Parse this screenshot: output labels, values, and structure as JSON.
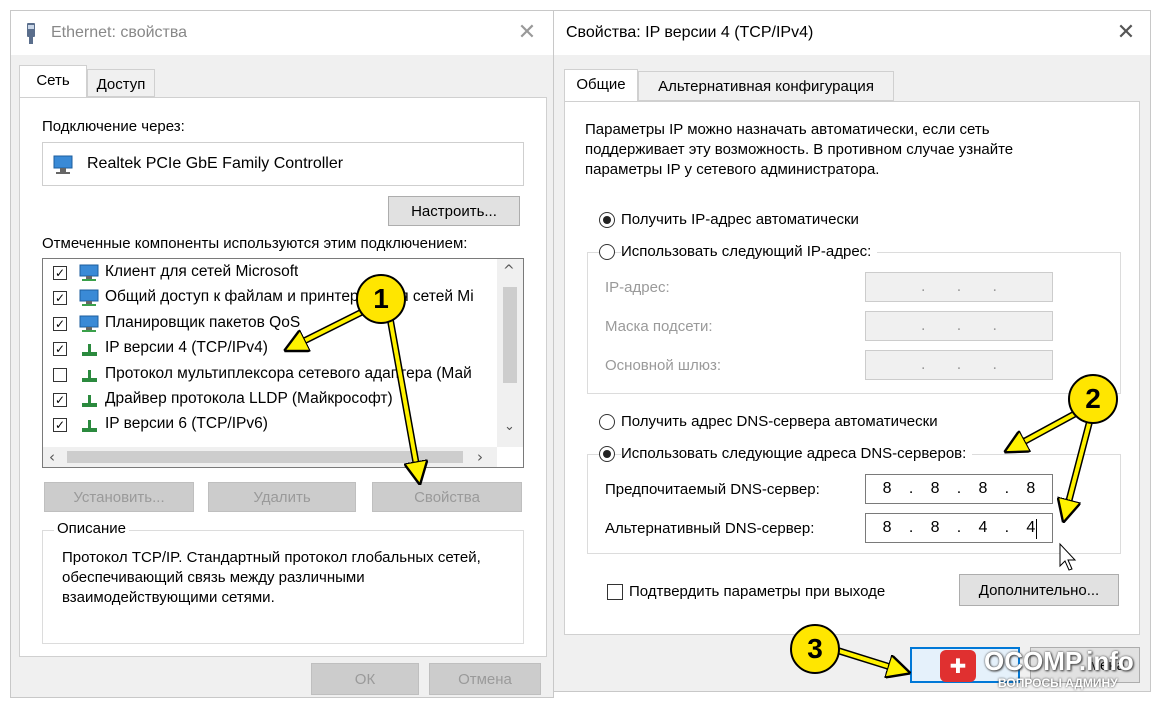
{
  "left_window": {
    "title": "Ethernet: свойства",
    "tabs": [
      "Сеть",
      "Доступ"
    ],
    "connect_via_label": "Подключение через:",
    "adapter_name": "Realtek PCIe GbE Family Controller",
    "configure_button": "Настроить...",
    "components_label": "Отмеченные компоненты используются этим подключением:",
    "components": [
      {
        "label": "Клиент для сетей Microsoft",
        "checked": true
      },
      {
        "label": "Общий доступ к файлам и принтерам для сетей Mi",
        "checked": true
      },
      {
        "label": "Планировщик пакетов QoS",
        "checked": true
      },
      {
        "label": "IP версии 4 (TCP/IPv4)",
        "checked": true
      },
      {
        "label": "Протокол мультиплексора сетевого адаптера (Май",
        "checked": false
      },
      {
        "label": "Драйвер протокола LLDP (Майкрософт)",
        "checked": true
      },
      {
        "label": "IP версии 6 (TCP/IPv6)",
        "checked": true
      }
    ],
    "install_button": "Установить...",
    "remove_button": "Удалить",
    "properties_button": "Свойства",
    "description_label": "Описание",
    "description_text": "Протокол TCP/IP. Стандартный протокол глобальных сетей, обеспечивающий связь между различными взаимодействующими сетями.",
    "ok_button": "ОК",
    "cancel_button": "Отмена"
  },
  "right_window": {
    "title": "Свойства: IP версии 4 (TCP/IPv4)",
    "tabs": [
      "Общие",
      "Альтернативная конфигурация"
    ],
    "intro_text": "Параметры IP можно назначать автоматически, если сеть поддерживает эту возможность. В противном случае узнайте параметры IP у сетевого администратора.",
    "auto_ip_label": "Получить IP-адрес автоматически",
    "manual_ip_label": "Использовать следующий IP-адрес:",
    "ip_address_label": "IP-адрес:",
    "subnet_label": "Маска подсети:",
    "gateway_label": "Основной шлюз:",
    "auto_dns_label": "Получить адрес DNS-сервера автоматически",
    "manual_dns_label": "Использовать следующие адреса DNS-серверов:",
    "preferred_dns_label": "Предпочитаемый DNS-сервер:",
    "preferred_dns_value": [
      "8",
      "8",
      "8",
      "8"
    ],
    "alternate_dns_label": "Альтернативный DNS-сервер:",
    "alternate_dns_value": [
      "8",
      "8",
      "4",
      "4"
    ],
    "validate_label": "Подтвердить параметры при выходе",
    "advanced_button": "Дополнительно...",
    "ok_partial": "ОК",
    "cancel_partial": "мена"
  },
  "annotations": {
    "badge1": "1",
    "badge2": "2",
    "badge3": "3",
    "arrow_color": "#fff200"
  },
  "watermark": {
    "site": "OCOMP.info",
    "tagline": "ВОПРОСЫ АДМИНУ"
  }
}
